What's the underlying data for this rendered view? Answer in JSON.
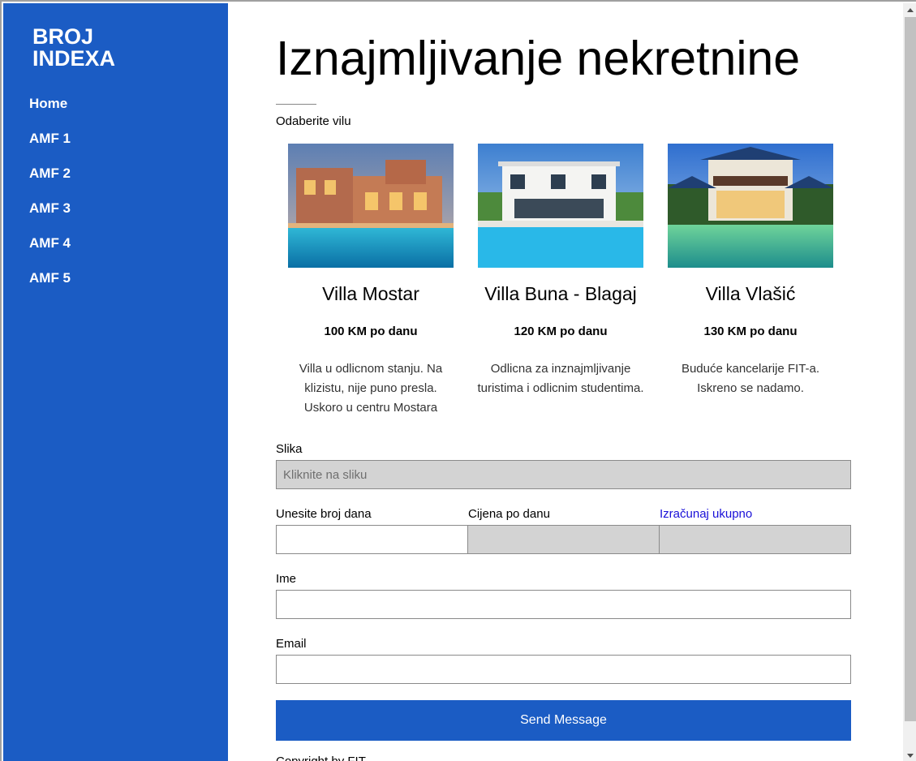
{
  "brand": {
    "line1": "BROJ",
    "line2": "INDEXA"
  },
  "nav": {
    "items": [
      {
        "label": "Home"
      },
      {
        "label": "AMF 1"
      },
      {
        "label": "AMF 2"
      },
      {
        "label": "AMF 3"
      },
      {
        "label": "AMF 4"
      },
      {
        "label": "AMF 5"
      }
    ]
  },
  "main": {
    "title": "Iznajmljivanje nekretnine",
    "subtitle": "Odaberite vilu"
  },
  "villas": [
    {
      "name": "Villa Mostar",
      "price": "100 KM po danu",
      "description": "Villa u odlicnom stanju. Na klizistu, nije puno presla. Uskoro u centru Mostara"
    },
    {
      "name": "Villa Buna - Blagaj",
      "price": "120 KM po danu",
      "description": "Odlicna za inznajmljivanje turistima i odlicnim studentima."
    },
    {
      "name": "Villa Vlašić",
      "price": "130 KM po danu",
      "description": "Buduće kancelarije FIT-a. Iskreno se nadamo."
    }
  ],
  "form": {
    "slika_label": "Slika",
    "slika_placeholder": "Kliknite na sliku",
    "days_label": "Unesite broj dana",
    "price_label": "Cijena po danu",
    "total_label": "Izračunaj ukupno",
    "ime_label": "Ime",
    "email_label": "Email",
    "send_label": "Send Message"
  },
  "footer": {
    "copyright": "Copyright by FIT"
  },
  "colors": {
    "primary": "#1b5cc4",
    "link": "#1a10d8",
    "field_disabled": "#d3d3d3"
  }
}
